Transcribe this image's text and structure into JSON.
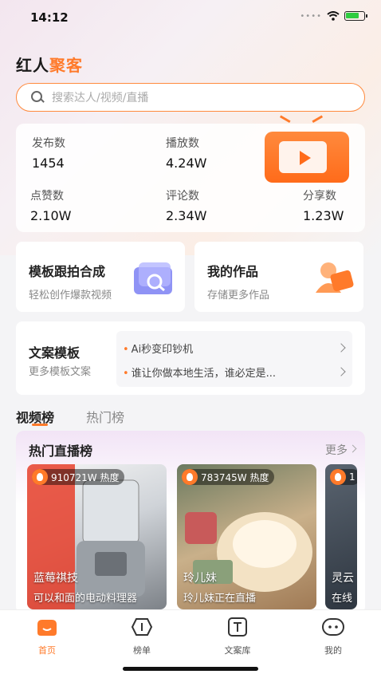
{
  "status_bar": {
    "time": "14:12"
  },
  "app": {
    "logo_main": "红人",
    "logo_accent": "聚客"
  },
  "search": {
    "placeholder": "搜索达人/视频/直播"
  },
  "stats": [
    {
      "label": "发布数",
      "value": "1454"
    },
    {
      "label": "播放数",
      "value": "4.24W"
    },
    {
      "label": "点赞数",
      "value": "2.10W"
    },
    {
      "label": "评论数",
      "value": "2.34W"
    },
    {
      "label": "分享数",
      "value": "1.23W"
    }
  ],
  "feature_cards": [
    {
      "title": "模板跟拍合成",
      "subtitle": "轻松创作爆款视频"
    },
    {
      "title": "我的作品",
      "subtitle": "存储更多作品"
    }
  ],
  "copy_template": {
    "title": "文案模板",
    "subtitle": "更多模板文案",
    "items": [
      "Ai秒变印钞机",
      "谁让你做本地生活，谁必定是..."
    ]
  },
  "tabs": [
    {
      "label": "视频榜",
      "active": true
    },
    {
      "label": "热门榜",
      "active": false
    }
  ],
  "live_section": {
    "title": "热门直播榜",
    "more_label": "更多",
    "cards": [
      {
        "heat": "910721W 热度",
        "name": "蓝莓祺技",
        "desc": "可以和面的电动料理器"
      },
      {
        "heat": "783745W 热度",
        "name": "玲儿妹",
        "desc": "玲儿妹正在直播"
      },
      {
        "heat": "1",
        "name": "灵云",
        "desc": "在线"
      }
    ]
  },
  "tabbar": [
    {
      "label": "首页",
      "icon": "home-icon",
      "active": true
    },
    {
      "label": "榜单",
      "icon": "ranking-icon",
      "active": false
    },
    {
      "label": "文案库",
      "icon": "text-library-icon",
      "active": false
    },
    {
      "label": "我的",
      "icon": "profile-icon",
      "active": false
    }
  ],
  "colors": {
    "accent": "#ff7a2a",
    "text": "#222222",
    "muted": "#888888"
  }
}
